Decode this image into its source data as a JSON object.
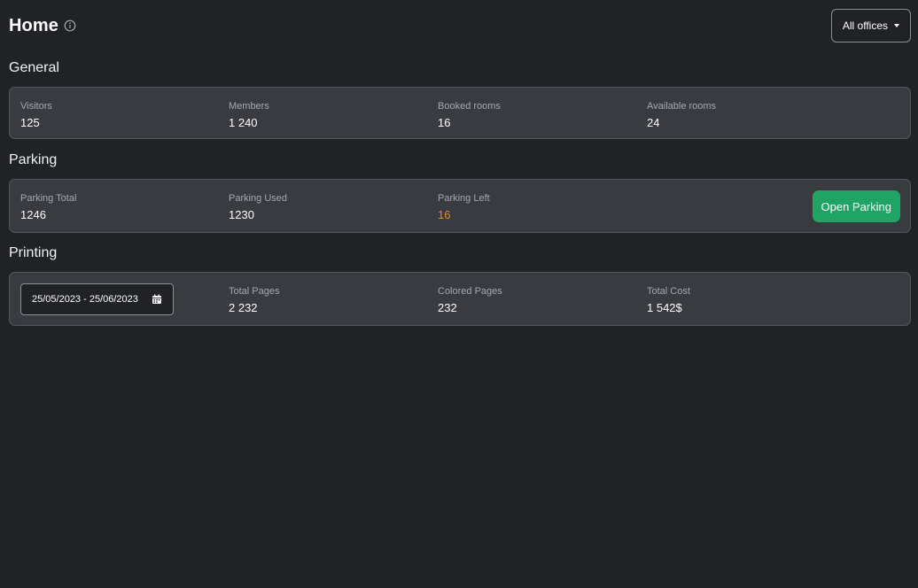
{
  "header": {
    "title": "Home",
    "office_select": "All offices"
  },
  "general": {
    "title": "General",
    "metrics": [
      {
        "label": "Visitors",
        "value": "125"
      },
      {
        "label": "Members",
        "value": "1 240"
      },
      {
        "label": "Booked rooms",
        "value": "16"
      },
      {
        "label": "Available rooms",
        "value": "24"
      }
    ]
  },
  "parking": {
    "title": "Parking",
    "metrics": [
      {
        "label": "Parking Total",
        "value": "1246"
      },
      {
        "label": "Parking Used",
        "value": "1230"
      },
      {
        "label": "Parking Left",
        "value": "16"
      }
    ],
    "open_button": "Open Parking"
  },
  "printing": {
    "title": "Printing",
    "date_range": "25/05/2023 - 25/06/2023",
    "metrics": [
      {
        "label": "Total Pages",
        "value": "2 232"
      },
      {
        "label": "Colored Pages",
        "value": "232"
      },
      {
        "label": "Total Cost",
        "value": "1 542$"
      }
    ]
  },
  "colors": {
    "background": "#202226",
    "card": "#393b41",
    "accent_green": "#1fa463",
    "warning_orange": "#e08a2e"
  }
}
